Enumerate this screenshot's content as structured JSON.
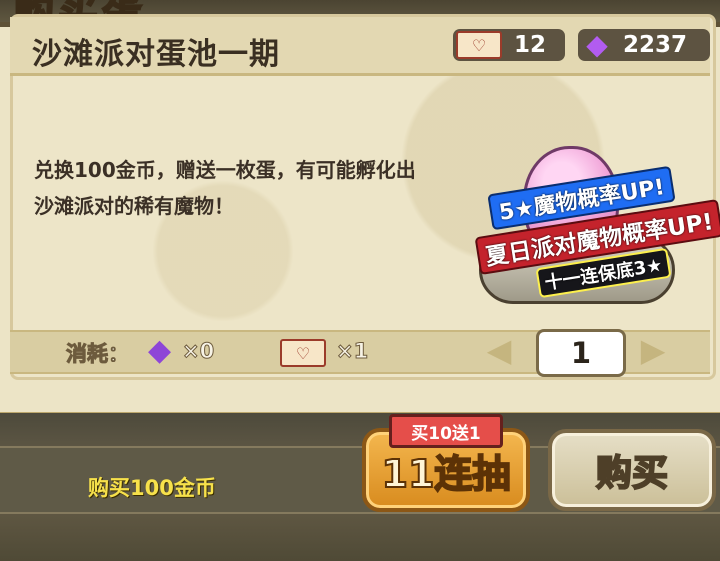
{
  "top_title_fragment": "购买蛋",
  "pool_title": "沙滩派对蛋池一期",
  "resources": {
    "ticket_icon": "ticket-icon",
    "ticket_count": "12",
    "gem_icon": "gem-icon",
    "gem_count": "2237"
  },
  "description": "兑换100金币，赠送一枚蛋，有可能孵化出沙滩派对的稀有魔物！",
  "banner": {
    "line1": "5★魔物概率UP!",
    "line2": "夏日派对魔物概率UP!",
    "line3": "十一连保底3★"
  },
  "cost": {
    "label": "消耗：",
    "gem_count": "×0",
    "ticket_count": "×1"
  },
  "quantity": "1",
  "buy_text": "购买100金币",
  "ten_pull": {
    "badge": "买10送1",
    "label": "11连抽"
  },
  "buy_button": {
    "label": "购买"
  }
}
